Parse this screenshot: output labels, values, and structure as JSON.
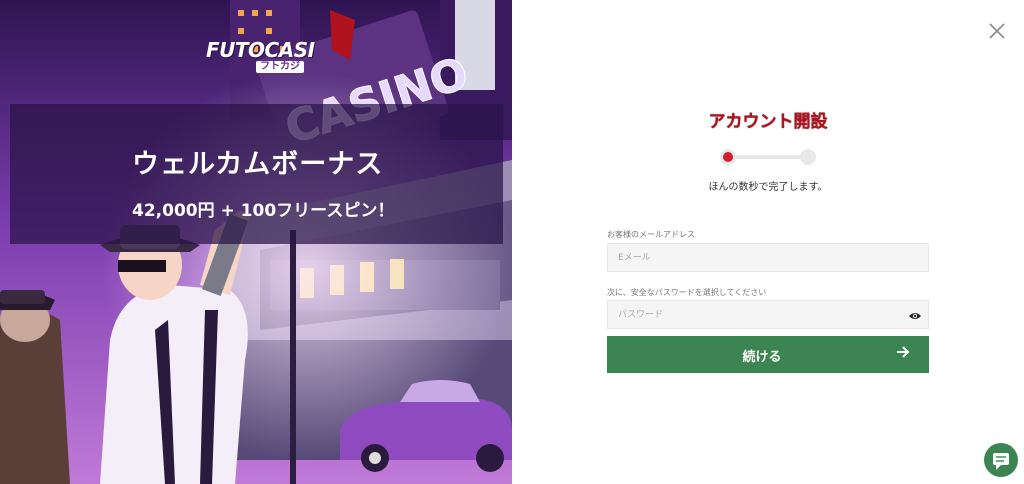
{
  "brand": {
    "logo_text": "FUTOCASI",
    "logo_sub": "フトカジ"
  },
  "promo": {
    "headline": "ウェルカムボーナス",
    "offer": "42,000円 + 100フリースピン！",
    "scene_sign": "CASINO"
  },
  "form": {
    "title": "アカウント開設",
    "subtitle": "ほんの数秒で完了します。",
    "email_label": "お客様のメールアドレス",
    "email_placeholder": "Eメール",
    "email_value": "",
    "password_label": "次に、安全なパスワードを選択してください",
    "password_placeholder": "パスワード",
    "password_value": "",
    "continue_label": "続ける",
    "step_current": 1,
    "step_total": 2
  },
  "icons": {
    "close": "close-icon",
    "eye": "eye-icon",
    "arrow": "arrow-right-icon",
    "chat": "chat-icon"
  },
  "colors": {
    "accent_green": "#3c8552",
    "title_red": "#b0121e",
    "step_red": "#d21e2e"
  }
}
